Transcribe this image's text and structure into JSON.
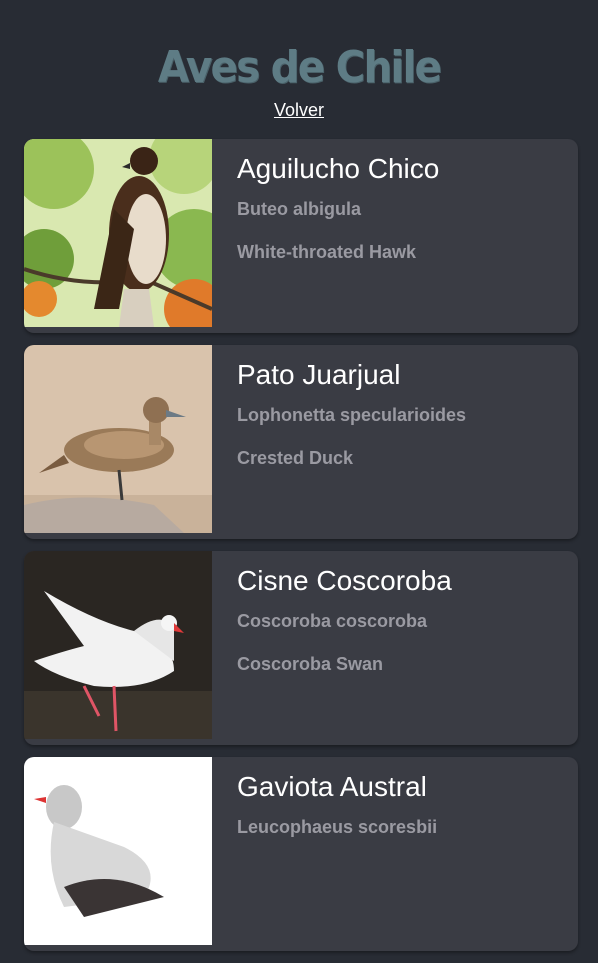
{
  "page": {
    "title": "Aves de Chile",
    "back_label": "Volver"
  },
  "birds": [
    {
      "common_name": "Aguilucho Chico",
      "scientific_name": "Buteo albigula",
      "english_name": "White-throated Hawk",
      "photo": "hawk-photo"
    },
    {
      "common_name": "Pato Juarjual",
      "scientific_name": "Lophonetta specularioides",
      "english_name": "Crested Duck",
      "photo": "duck-photo"
    },
    {
      "common_name": "Cisne Coscoroba",
      "scientific_name": "Coscoroba coscoroba",
      "english_name": "Coscoroba Swan",
      "photo": "swan-photo"
    },
    {
      "common_name": "Gaviota Austral",
      "scientific_name": "Leucophaeus scoresbii",
      "english_name": "",
      "photo": "gull-photo"
    }
  ],
  "colors": {
    "background": "#282c34",
    "card": "#3a3c44",
    "title": "#5e7c85",
    "secondary_text": "#9a9aa2"
  }
}
